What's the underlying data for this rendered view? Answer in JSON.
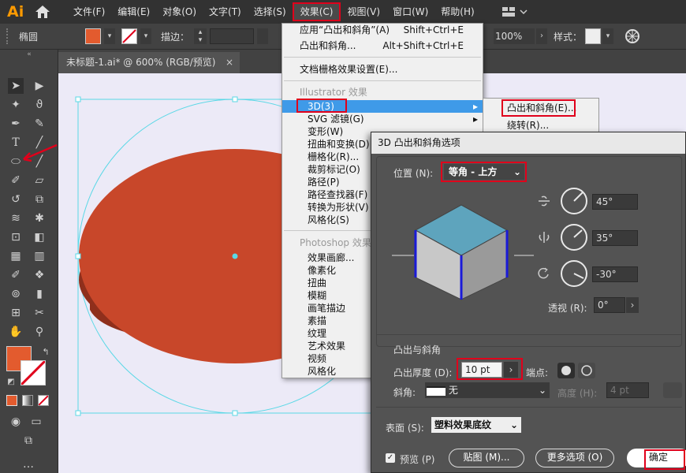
{
  "app": {
    "logo": "Ai"
  },
  "menubar": {
    "items": [
      "文件(F)",
      "编辑(E)",
      "对象(O)",
      "文字(T)",
      "选择(S)",
      "效果(C)",
      "视图(V)",
      "窗口(W)",
      "帮助(H)"
    ],
    "active_index": 5
  },
  "options_bar": {
    "shape_name": "椭圆",
    "stroke_label": "描边：",
    "zoom": "100%",
    "style_label": "样式："
  },
  "document_tab": {
    "title": "未标题-1.ai* @ 600% (RGB/预览)",
    "close": "×"
  },
  "effect_menu": {
    "apply_last": "应用“凸出和斜角”(A)",
    "apply_last_shortcut": "Shift+Ctrl+E",
    "last_effect": "凸出和斜角...",
    "last_effect_shortcut": "Alt+Shift+Ctrl+E",
    "raster_settings": "文档栅格效果设置(E)...",
    "illustrator_header": "Illustrator 效果",
    "illustrator_items": [
      "3D(3)",
      "SVG 滤镜(G)",
      "变形(W)",
      "扭曲和变换(D)",
      "栅格化(R)...",
      "裁剪标记(O)",
      "路径(P)",
      "路径查找器(F)",
      "转换为形状(V)",
      "风格化(S)"
    ],
    "photoshop_header": "Photoshop 效果",
    "photoshop_items": [
      "效果画廊...",
      "像素化",
      "扭曲",
      "模糊",
      "画笔描边",
      "素描",
      "纹理",
      "艺术效果",
      "视频",
      "风格化"
    ]
  },
  "submenu_3d": {
    "items": [
      "凸出和斜角(E)...",
      "绕转(R)..."
    ]
  },
  "dialog": {
    "title": "3D 凸出和斜角选项",
    "position_label": "位置 (N):",
    "position_value": "等角 - 上方",
    "angle_x": "45°",
    "angle_y": "35°",
    "angle_z": "-30°",
    "perspective_label": "透视 (R):",
    "perspective_value": "0°",
    "extrude_section": "凸出与斜角",
    "depth_label": "凸出厚度 (D):",
    "depth_value": "10 pt",
    "cap_label": "端点:",
    "bevel_label": "斜角:",
    "bevel_value": "无",
    "height_label": "高度 (H):",
    "height_value": "4 pt",
    "surface_label": "表面 (S):",
    "surface_value": "塑料效果底纹",
    "preview_label": "预览 (P)",
    "preview_checked": true,
    "map_button": "贴图 (M)...",
    "more_button": "更多选项 (O)",
    "ok_button": "确定"
  },
  "colors": {
    "fill": "#e35b2e",
    "ellipse": "#c8472a",
    "ellipse_side": "#8f2f1c",
    "guide": "#5ad8e6",
    "highlight": "#e0001b",
    "menu_hover": "#3f9ae8",
    "cube_top": "#5ea4bd",
    "cube_left": "#c8c8c8",
    "cube_right": "#9a9a9a"
  }
}
